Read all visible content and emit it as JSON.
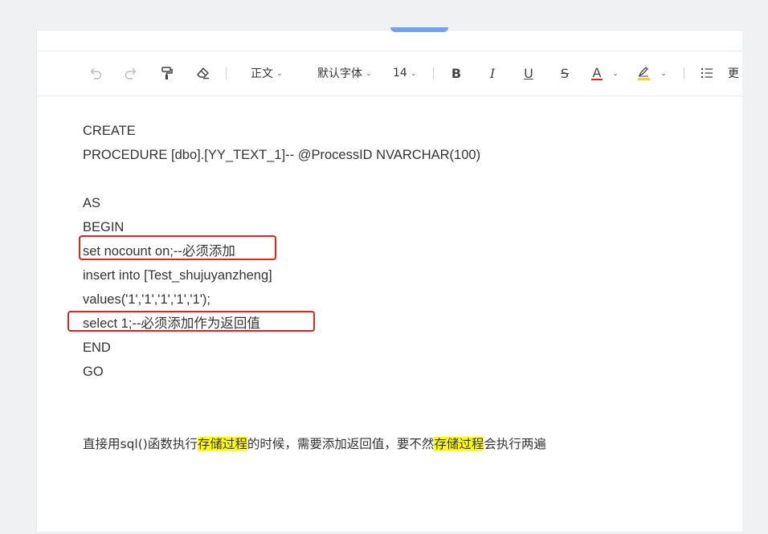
{
  "toolbar": {
    "undo_icon": "undo-icon",
    "redo_icon": "redo-icon",
    "format_painter_icon": "format-painter-icon",
    "eraser_icon": "eraser-icon",
    "paragraph_style": "正文",
    "font_family": "默认字体",
    "font_size": "14",
    "bold_label": "B",
    "italic_label": "I",
    "underline_label": "U",
    "strike_label": "S",
    "font_color_label": "A",
    "font_color": "#e8231e",
    "highlight_color": "#ffd800",
    "more_label": "更"
  },
  "document": {
    "lines": [
      "CREATE",
      "PROCEDURE [dbo].[YY_TEXT_1]-- @ProcessID NVARCHAR(100)",
      "",
      "AS",
      "BEGIN",
      "set nocount on;--必须添加",
      "insert into  [Test_shujuyanzheng]",
      "values('1','1','1','1','1');",
      "select 1;--必须添加作为返回值",
      "END",
      "GO"
    ],
    "note": {
      "part1": "直接用sql()函数执行",
      "highlight1": "存储过程",
      "part2": "的时候，需要添加返回值，要不然",
      "highlight2": "存储过程",
      "part3": "会执行两遍"
    },
    "highlight_color": "#ffff00",
    "annotation_color": "#e8231e"
  }
}
